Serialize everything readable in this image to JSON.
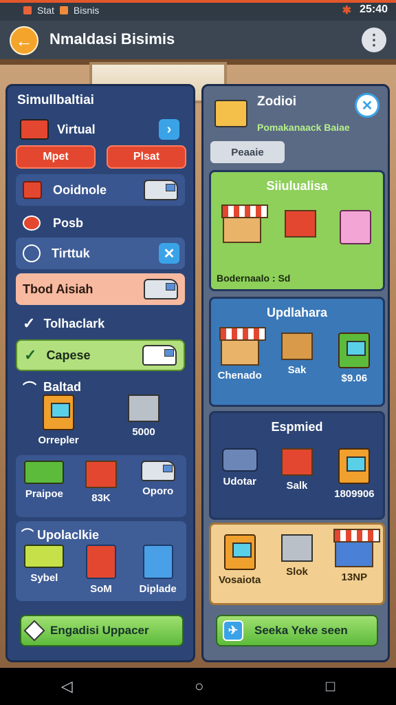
{
  "status": {
    "left_text": "Stat",
    "app_name": "Bisnis",
    "time": "25:40",
    "signal_glyph": "✱"
  },
  "appbar": {
    "title": "Nmaldasi Bisimis"
  },
  "left": {
    "title": "Simullbaltiai",
    "virtual_label": "Virtual",
    "btn_a": "Mpet",
    "btn_b": "Plsat",
    "rows": [
      {
        "label": "Ooidnole"
      },
      {
        "label": "Posb"
      },
      {
        "label": "Tirttuk"
      },
      {
        "label": "Tbod Aisiah"
      },
      {
        "label": "Tolhaclark"
      },
      {
        "label": "Capese"
      },
      {
        "label": "Baltad"
      }
    ],
    "grid1": [
      {
        "caption": "Orrepler"
      },
      {
        "caption": "5000"
      }
    ],
    "grid2": [
      {
        "caption": "Praipoe"
      },
      {
        "caption": "83K"
      },
      {
        "caption": "Oporo"
      }
    ],
    "section_title": "Upolaclkie",
    "grid3": [
      {
        "caption": "Sybel"
      },
      {
        "caption": "SoM"
      },
      {
        "caption": "Diplade"
      }
    ],
    "bottom_button": "Engadisi Uppacer"
  },
  "right": {
    "title": "Zodioi",
    "subtitle": "Pomakanaack Baiae",
    "tab": "Peaaie",
    "card1": {
      "title": "Siiulualisa",
      "footer": "Bodernaalo : Sd"
    },
    "card2": {
      "title": "Updlahara",
      "captions": [
        "Chenado",
        "Sak",
        "$9.06"
      ]
    },
    "card3": {
      "title": "Espmied",
      "captions": [
        "Udotar",
        "Salk",
        "1809906"
      ]
    },
    "card4": {
      "captions": [
        "Vosaiota",
        "Slok",
        "13NP"
      ]
    },
    "bottom_button": "Seeka Yeke seen"
  },
  "colors": {
    "accent": "#e2572b",
    "panel_left": "#2c4576",
    "green": "#5dbb3c",
    "blue_chip": "#3aa3e8"
  }
}
